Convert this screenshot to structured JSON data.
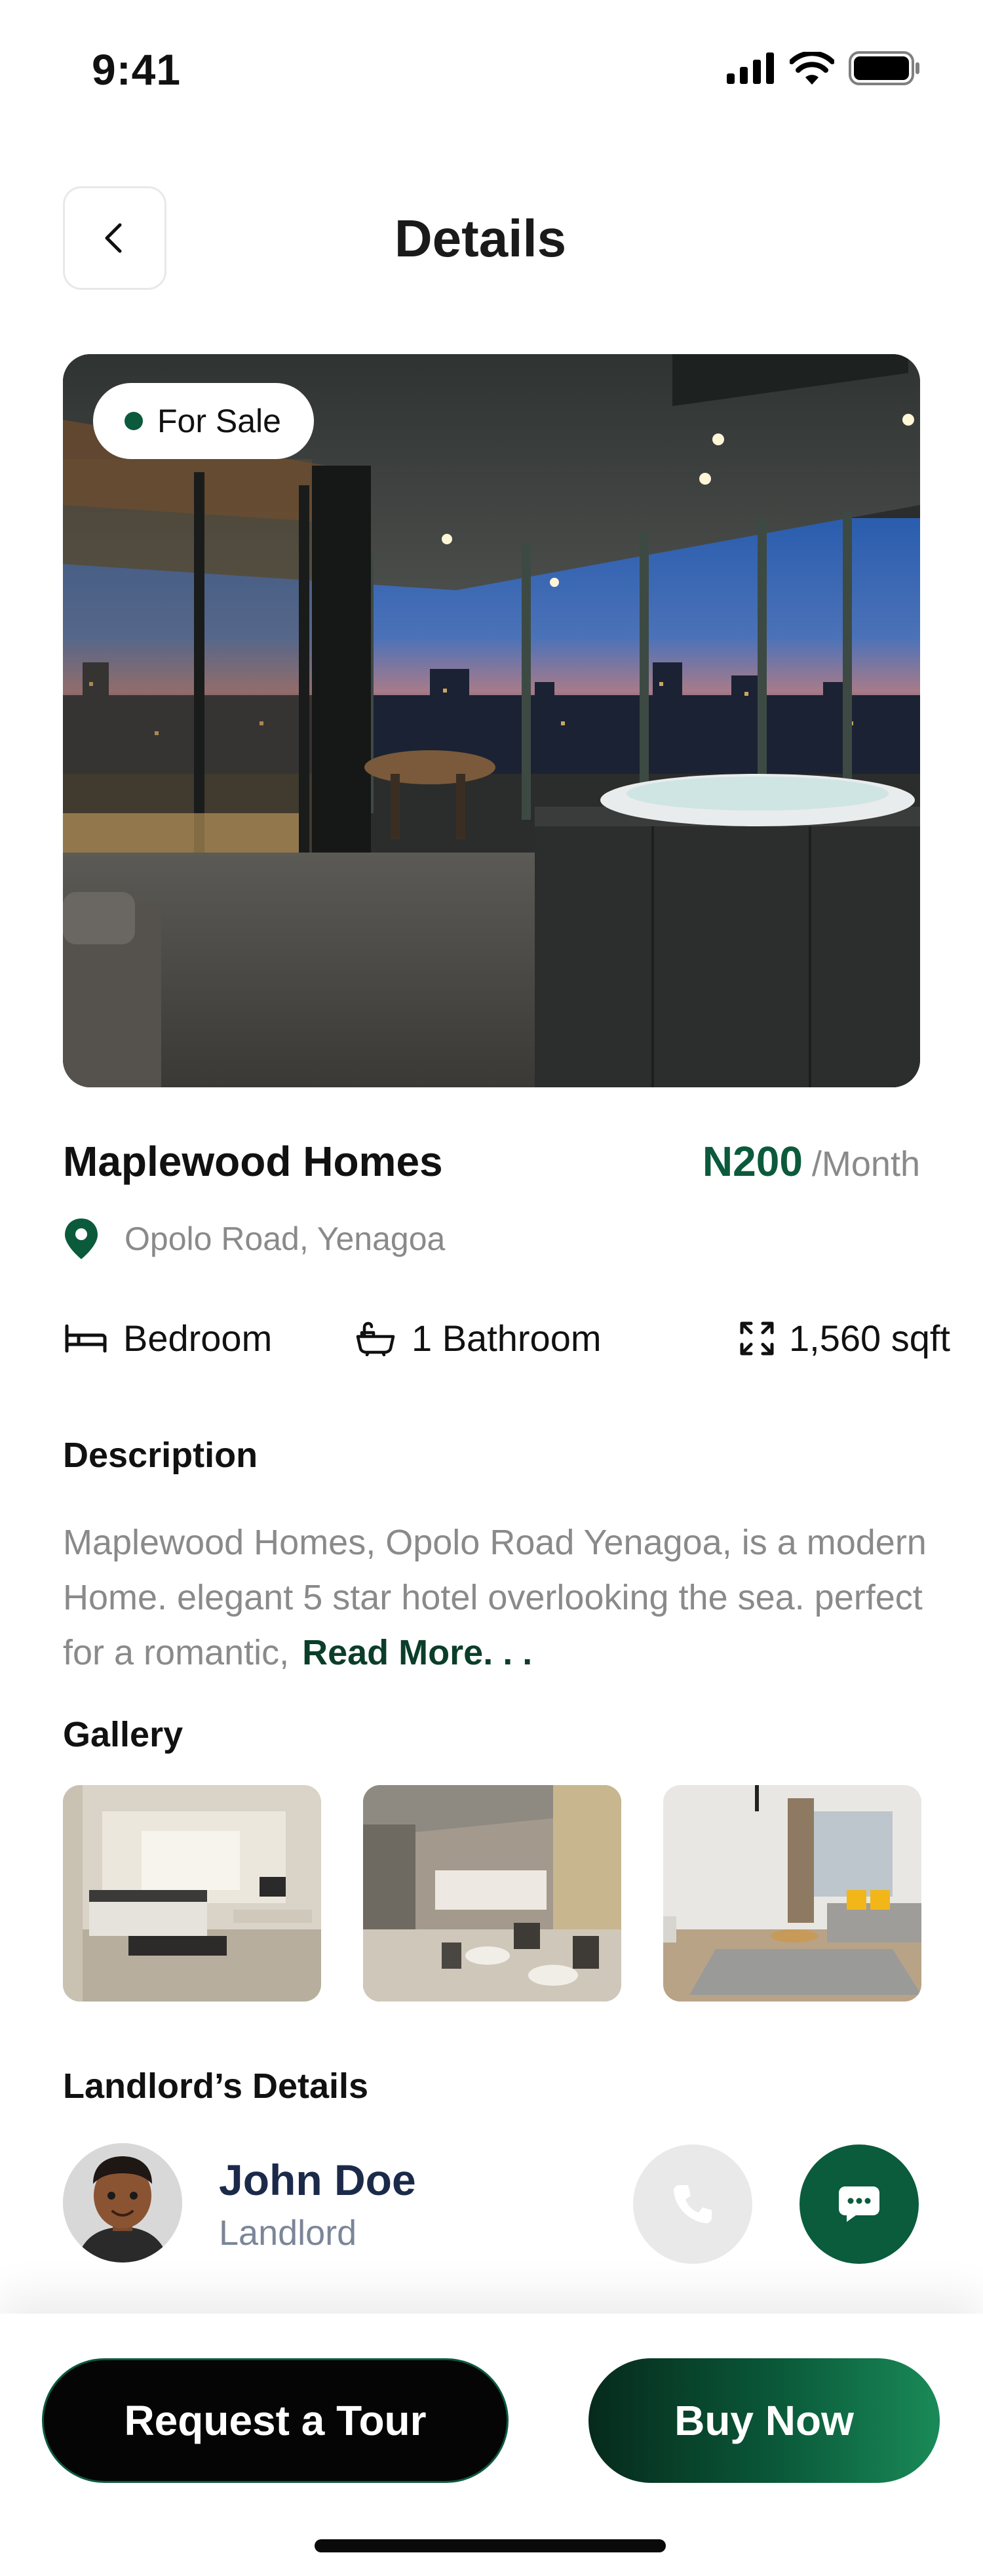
{
  "status_bar": {
    "time": "9:41"
  },
  "header": {
    "title": "Details"
  },
  "hero": {
    "badge": "For Sale"
  },
  "property": {
    "name": "Maplewood Homes",
    "price": "N200",
    "price_period": "/Month",
    "location": "Opolo Road, Yenagoa"
  },
  "features": [
    {
      "icon": "bed-icon",
      "label": "Bedroom"
    },
    {
      "icon": "bathtub-icon",
      "label": "1 Bathroom"
    },
    {
      "icon": "area-expand-icon",
      "label": "1,560 sqft"
    }
  ],
  "description": {
    "title": "Description",
    "text": "Maplewood Homes, Opolo Road Yenagoa, is a modern Home. elegant 5 star hotel overlooking the sea. perfect for a romantic,",
    "read_more": "Read More. . ."
  },
  "gallery": {
    "title": "Gallery"
  },
  "landlord": {
    "title": "Landlord’s Details",
    "name": "John Doe",
    "role": "Landlord"
  },
  "actions": {
    "request_tour": "Request a Tour",
    "buy_now": "Buy Now"
  },
  "colors": {
    "brand": "#0b5a3c",
    "brand_dark": "#062a1c",
    "muted_text": "#8a8a8a"
  }
}
